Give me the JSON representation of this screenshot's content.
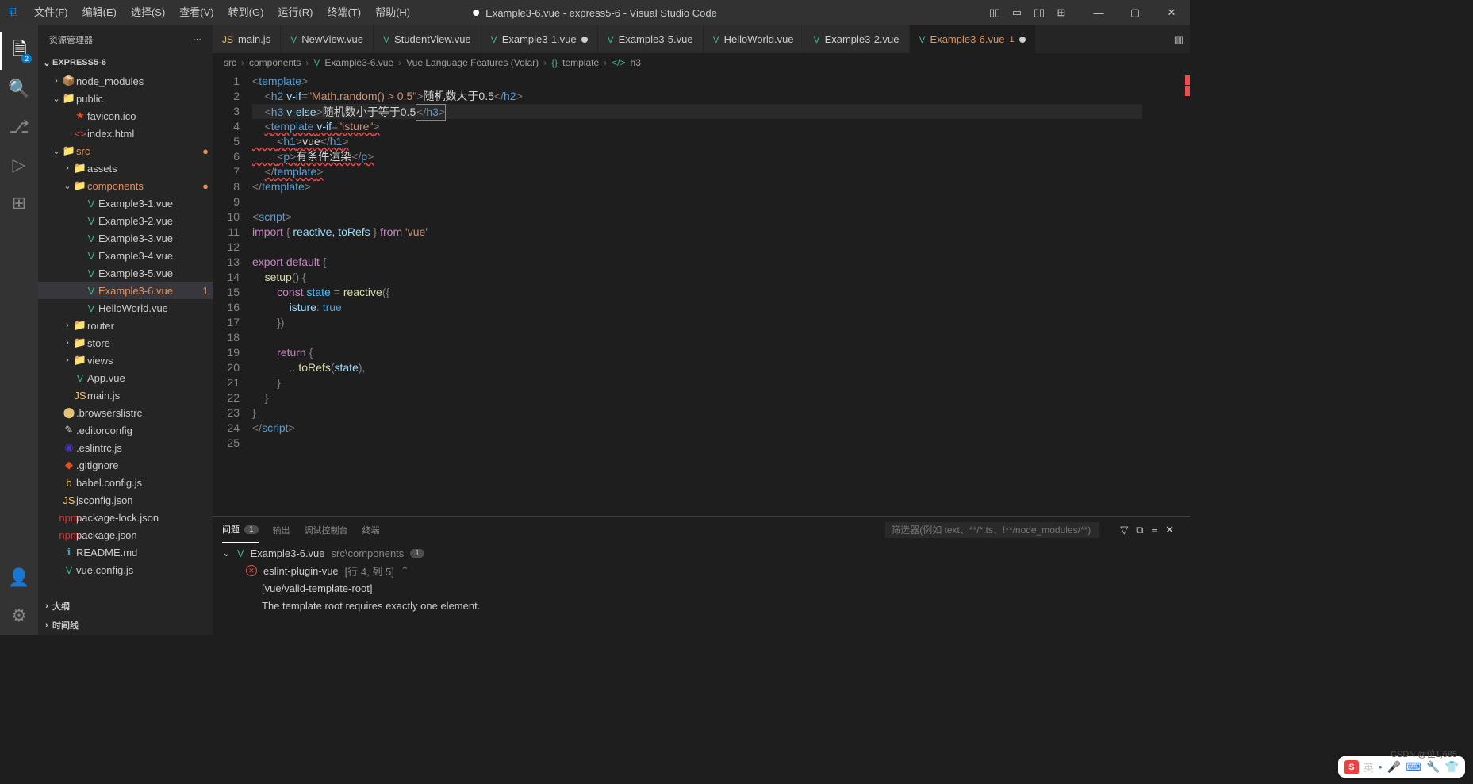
{
  "titlebar": {
    "menus": [
      "文件(F)",
      "编辑(E)",
      "选择(S)",
      "查看(V)",
      "转到(G)",
      "运行(R)",
      "终端(T)",
      "帮助(H)"
    ],
    "title": "Example3-6.vue - express5-6 - Visual Studio Code",
    "modified": true
  },
  "activitybar": {
    "explorer_badge": "2"
  },
  "sidebar": {
    "title": "资源管理器",
    "sections": {
      "project": "EXPRESS5-6",
      "outline": "大纲",
      "timeline": "时间线"
    },
    "tree": [
      {
        "d": 1,
        "chev": "›",
        "ico": "📦",
        "col": "#81b88b",
        "lbl": "node_modules"
      },
      {
        "d": 1,
        "chev": "⌄",
        "ico": "📁",
        "col": "#e6c176",
        "lbl": "public"
      },
      {
        "d": 2,
        "chev": "",
        "ico": "★",
        "col": "#e44d26",
        "lbl": "favicon.ico"
      },
      {
        "d": 2,
        "chev": "",
        "ico": "<>",
        "col": "#e44d26",
        "lbl": "index.html"
      },
      {
        "d": 1,
        "chev": "⌄",
        "ico": "📁",
        "col": "#e6c176",
        "lbl": "src",
        "mod": "●",
        "modcol": "#e2915b",
        "lblcol": "#e2915b"
      },
      {
        "d": 2,
        "chev": "›",
        "ico": "📁",
        "col": "#e6c176",
        "lbl": "assets"
      },
      {
        "d": 2,
        "chev": "⌄",
        "ico": "📁",
        "col": "#e6c176",
        "lbl": "components",
        "mod": "●",
        "modcol": "#e2915b",
        "lblcol": "#e2915b"
      },
      {
        "d": 3,
        "chev": "",
        "ico": "V",
        "col": "#41b883",
        "lbl": "Example3-1.vue"
      },
      {
        "d": 3,
        "chev": "",
        "ico": "V",
        "col": "#41b883",
        "lbl": "Example3-2.vue"
      },
      {
        "d": 3,
        "chev": "",
        "ico": "V",
        "col": "#41b883",
        "lbl": "Example3-3.vue"
      },
      {
        "d": 3,
        "chev": "",
        "ico": "V",
        "col": "#41b883",
        "lbl": "Example3-4.vue"
      },
      {
        "d": 3,
        "chev": "",
        "ico": "V",
        "col": "#41b883",
        "lbl": "Example3-5.vue"
      },
      {
        "d": 3,
        "chev": "",
        "ico": "V",
        "col": "#41b883",
        "lbl": "Example3-6.vue",
        "lblcol": "#e2915b",
        "mod": "1",
        "modcol": "#e2915b",
        "active": true
      },
      {
        "d": 3,
        "chev": "",
        "ico": "V",
        "col": "#41b883",
        "lbl": "HelloWorld.vue"
      },
      {
        "d": 2,
        "chev": "›",
        "ico": "📁",
        "col": "#e6c176",
        "lbl": "router"
      },
      {
        "d": 2,
        "chev": "›",
        "ico": "📁",
        "col": "#e6c176",
        "lbl": "store"
      },
      {
        "d": 2,
        "chev": "›",
        "ico": "📁",
        "col": "#e6c176",
        "lbl": "views"
      },
      {
        "d": 2,
        "chev": "",
        "ico": "V",
        "col": "#41b883",
        "lbl": "App.vue"
      },
      {
        "d": 2,
        "chev": "",
        "ico": "JS",
        "col": "#e6c176",
        "lbl": "main.js"
      },
      {
        "d": 1,
        "chev": "",
        "ico": "⬤",
        "col": "#e6c176",
        "lbl": ".browserslistrc"
      },
      {
        "d": 1,
        "chev": "",
        "ico": "✎",
        "col": "#ccc",
        "lbl": ".editorconfig"
      },
      {
        "d": 1,
        "chev": "",
        "ico": "◉",
        "col": "#4b32c3",
        "lbl": ".eslintrc.js"
      },
      {
        "d": 1,
        "chev": "",
        "ico": "◆",
        "col": "#e44d26",
        "lbl": ".gitignore"
      },
      {
        "d": 1,
        "chev": "",
        "ico": "b",
        "col": "#e6c176",
        "lbl": "babel.config.js"
      },
      {
        "d": 1,
        "chev": "",
        "ico": "JS",
        "col": "#e6c176",
        "lbl": "jsconfig.json"
      },
      {
        "d": 1,
        "chev": "",
        "ico": "npm",
        "col": "#cb3837",
        "lbl": "package-lock.json"
      },
      {
        "d": 1,
        "chev": "",
        "ico": "npm",
        "col": "#cb3837",
        "lbl": "package.json"
      },
      {
        "d": 1,
        "chev": "",
        "ico": "ℹ",
        "col": "#519aba",
        "lbl": "README.md"
      },
      {
        "d": 1,
        "chev": "",
        "ico": "V",
        "col": "#41b883",
        "lbl": "vue.config.js"
      }
    ]
  },
  "tabs": [
    {
      "ico": "JS",
      "icocls": "js",
      "lbl": "main.js"
    },
    {
      "ico": "V",
      "lbl": "NewView.vue"
    },
    {
      "ico": "V",
      "lbl": "StudentView.vue"
    },
    {
      "ico": "V",
      "lbl": "Example3-1.vue",
      "dot": true
    },
    {
      "ico": "V",
      "lbl": "Example3-5.vue"
    },
    {
      "ico": "V",
      "lbl": "HelloWorld.vue"
    },
    {
      "ico": "V",
      "lbl": "Example3-2.vue"
    },
    {
      "ico": "V",
      "lbl": "Example3-6.vue",
      "lblcls": "mod",
      "badge": "1",
      "dot": true,
      "active": true
    }
  ],
  "breadcrumb": {
    "items": [
      "src",
      "components",
      "Example3-6.vue",
      "Vue Language Features (Volar)",
      "template",
      "h3"
    ],
    "icos": [
      "",
      "",
      "V",
      "",
      "{}",
      "</>"
    ]
  },
  "code": {
    "lines": [
      {
        "n": 1,
        "html": "<span class='k-punc'>&lt;</span><span class='k-tag'>template</span><span class='k-punc'>&gt;</span>"
      },
      {
        "n": 2,
        "html": "    <span class='k-punc'>&lt;</span><span class='k-tag'>h2</span> <span class='k-attr'>v-if</span><span class='k-punc'>=</span><span class='k-str'>\"Math.random() &gt; 0.5\"</span><span class='k-punc'>&gt;</span><span class='k-txt'>随机数大于0.5</span><span class='k-punc'>&lt;/</span><span class='k-tag'>h2</span><span class='k-punc'>&gt;</span>"
      },
      {
        "n": 3,
        "hl": true,
        "html": "    <span class='k-punc'>&lt;</span><span class='k-tag'>h3</span> <span class='k-attr'>v-else</span><span class='k-punc'>&gt;</span><span class='k-txt'>随机数小于等于0.5</span><span class='cursor-box'><span class='k-punc'>&lt;/</span><span class='k-tag'>h3</span><span class='k-punc'>&gt;</span></span>"
      },
      {
        "n": 4,
        "html": "    <span class='squiggle'><span class='k-punc'>&lt;</span><span class='k-tag'>template</span> <span class='k-attr'>v-if</span><span class='k-punc'>=</span><span class='k-str'>\"isture\"</span><span class='k-punc'>&gt;</span></span>"
      },
      {
        "n": 5,
        "html": "<span class='squiggle'>        <span class='k-punc'>&lt;</span><span class='k-tag'>h1</span><span class='k-punc'>&gt;</span><span class='k-txt'>vue</span><span class='k-punc'>&lt;/</span><span class='k-tag'>h1</span><span class='k-punc'>&gt;</span></span>"
      },
      {
        "n": 6,
        "html": "<span class='squiggle'>        <span class='k-punc'>&lt;</span><span class='k-tag'>p</span><span class='k-punc'>&gt;</span><span class='k-txt'>有条件渲染</span><span class='k-punc'>&lt;/</span><span class='k-tag'>p</span><span class='k-punc'>&gt;</span></span>"
      },
      {
        "n": 7,
        "html": "    <span class='squiggle'><span class='k-punc'>&lt;/</span><span class='k-tag'>template</span><span class='k-punc'>&gt;</span></span>"
      },
      {
        "n": 8,
        "html": "<span class='k-punc'>&lt;/</span><span class='k-tag'>template</span><span class='k-punc'>&gt;</span>"
      },
      {
        "n": 9,
        "html": ""
      },
      {
        "n": 10,
        "html": "<span class='k-punc'>&lt;</span><span class='k-tag'>script</span><span class='k-punc'>&gt;</span>"
      },
      {
        "n": 11,
        "html": "<span class='k-kw'>import</span> <span class='k-punc'>{</span> <span class='k-var'>reactive</span>, <span class='k-var'>toRefs</span> <span class='k-punc'>}</span> <span class='k-kw'>from</span> <span class='k-str'>'vue'</span>"
      },
      {
        "n": 12,
        "html": ""
      },
      {
        "n": 13,
        "html": "<span class='k-kw'>export</span> <span class='k-kw'>default</span> <span class='k-punc'>{</span>"
      },
      {
        "n": 14,
        "html": "    <span class='k-fn'>setup</span><span class='k-punc'>() {</span>"
      },
      {
        "n": 15,
        "html": "        <span class='k-kw'>const</span> <span class='k-const'>state</span> <span class='k-punc'>=</span> <span class='k-fn'>reactive</span><span class='k-punc'>({</span>"
      },
      {
        "n": 16,
        "html": "            <span class='k-var'>isture</span><span class='k-punc'>:</span> <span class='k-bool'>true</span>"
      },
      {
        "n": 17,
        "html": "        <span class='k-punc'>})</span>"
      },
      {
        "n": 18,
        "html": ""
      },
      {
        "n": 19,
        "html": "        <span class='k-kw'>return</span> <span class='k-punc'>{</span>"
      },
      {
        "n": 20,
        "html": "            <span class='k-punc'>...</span><span class='k-fn'>toRefs</span><span class='k-punc'>(</span><span class='k-var'>state</span><span class='k-punc'>),</span>"
      },
      {
        "n": 21,
        "html": "        <span class='k-punc'>}</span>"
      },
      {
        "n": 22,
        "html": "    <span class='k-punc'>}</span>"
      },
      {
        "n": 23,
        "html": "<span class='k-punc'>}</span>"
      },
      {
        "n": 24,
        "html": "<span class='k-punc'>&lt;/</span><span class='k-tag'>script</span><span class='k-punc'>&gt;</span>"
      },
      {
        "n": 25,
        "html": ""
      }
    ]
  },
  "panel": {
    "tabs": {
      "problems": "问题",
      "output": "输出",
      "debug": "调试控制台",
      "terminal": "终端"
    },
    "problems_count": "1",
    "filter_placeholder": "筛选器(例如 text、**/*.ts、!**/node_modules/**)",
    "file": {
      "name": "Example3-6.vue",
      "path": "src\\components",
      "count": "1"
    },
    "source": "eslint-plugin-vue",
    "loc": "[行 4, 列 5]",
    "rule": "[vue/valid-template-root]",
    "msg": "The template root requires exactly one element."
  },
  "ime": {
    "lang": "英",
    "dot": "•"
  },
  "watermark": "CSDN @位1,685"
}
